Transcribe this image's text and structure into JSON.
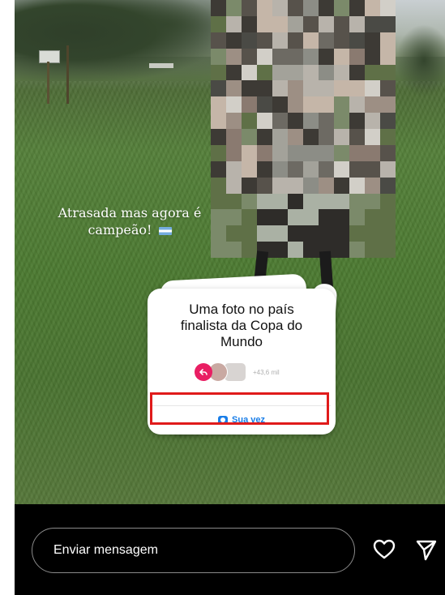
{
  "story": {
    "caption_line1": "Atrasada mas agora é",
    "caption_line2": "campeão!",
    "caption_emoji": "argentina-flag"
  },
  "prompt_card": {
    "title_line1": "Uma foto no país",
    "title_line2": "finalista da Copa do",
    "title_line3": "Mundo",
    "participants_count": "+43,6 mil",
    "action_label": "Sua vez",
    "action_icon": "camera-icon",
    "highlight_color": "#e01b1b",
    "action_color": "#1a7ee8"
  },
  "footer": {
    "message_placeholder": "Enviar mensagem",
    "like_icon": "heart-icon",
    "send_icon": "send-icon"
  }
}
